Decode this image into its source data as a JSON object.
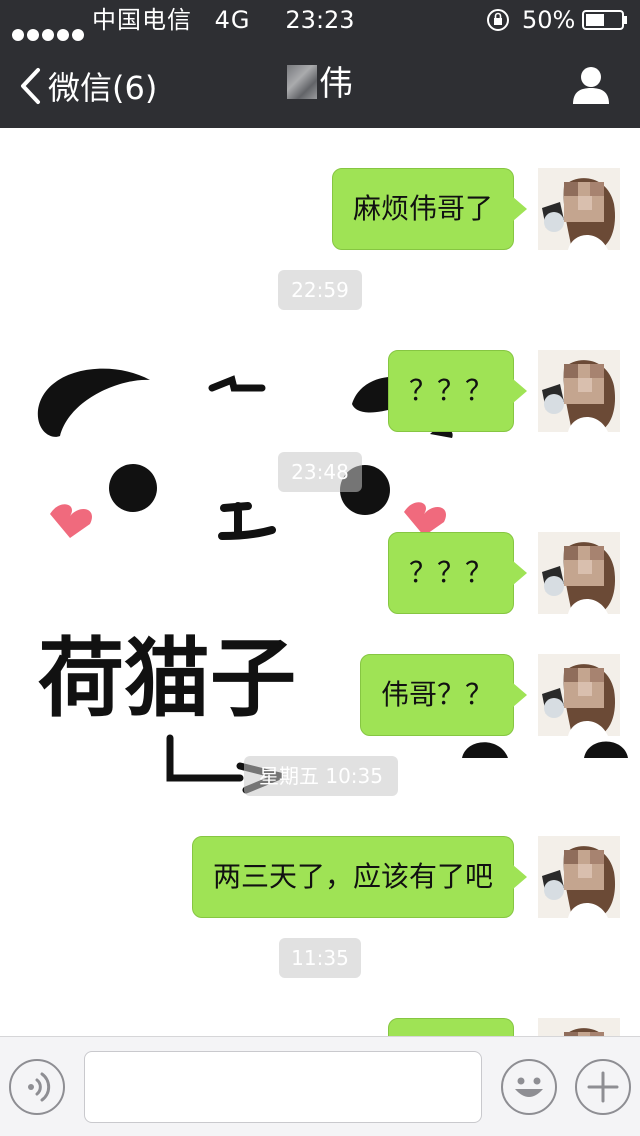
{
  "status_bar": {
    "carrier": "中国电信",
    "network": "4G",
    "time": "23:23",
    "battery": "50%"
  },
  "nav": {
    "back_label": "微信(6)",
    "title": "伟"
  },
  "sticker": {
    "text": "荷猫子"
  },
  "messages": [
    {
      "type": "bubble",
      "text": "麻烦伟哥了"
    },
    {
      "type": "time",
      "text": "22:59"
    },
    {
      "type": "bubble",
      "text": "？？？"
    },
    {
      "type": "time",
      "text": "23:48"
    },
    {
      "type": "bubble",
      "text": "？？？"
    },
    {
      "type": "bubble",
      "text": "伟哥？？"
    },
    {
      "type": "time",
      "text": "星期五 10:35"
    },
    {
      "type": "bubble",
      "text": "两三天了，应该有了吧"
    },
    {
      "type": "time",
      "text": "11:35"
    },
    {
      "type": "bubble",
      "text": ""
    }
  ],
  "colors": {
    "header_bg": "#2e2f33",
    "bubble_green": "#9fe355",
    "timestamp_bg": "#c8c8c8"
  },
  "icons": {
    "back": "chevron-left-icon",
    "profile": "person-icon",
    "voice": "voice-icon",
    "emoji": "smiley-icon",
    "more": "plus-icon"
  }
}
